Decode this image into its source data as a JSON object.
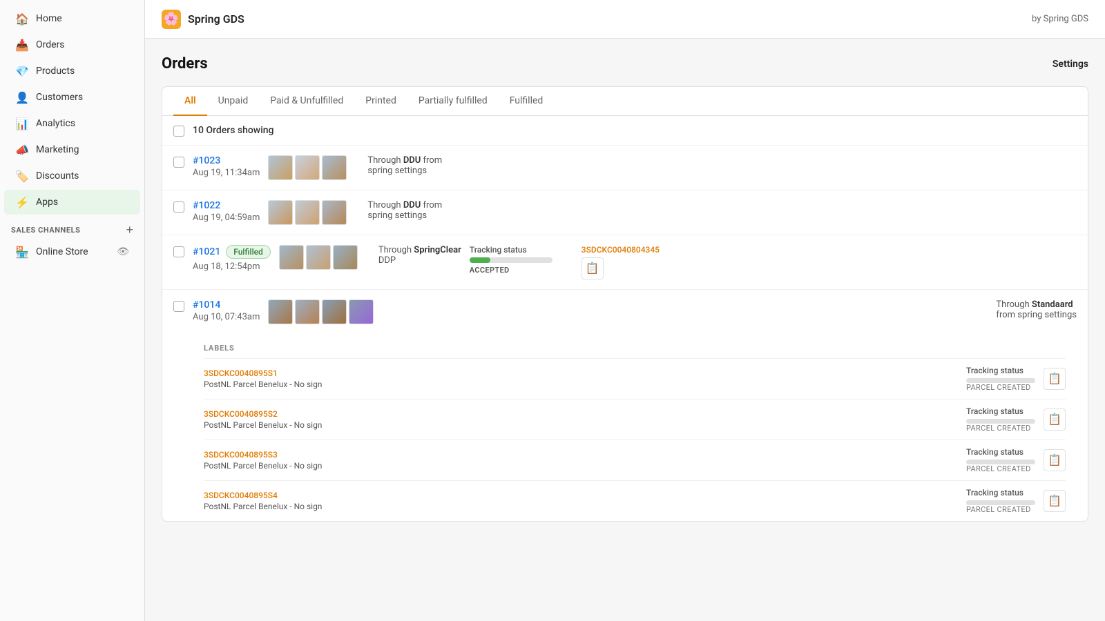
{
  "topbar": {
    "app_name": "Spring GDS",
    "byline": "by Spring GDS",
    "logo_emoji": "🌸"
  },
  "sidebar": {
    "items": [
      {
        "id": "home",
        "label": "Home",
        "icon": "🏠"
      },
      {
        "id": "orders",
        "label": "Orders",
        "icon": "📥"
      },
      {
        "id": "products",
        "label": "Products",
        "icon": "💎"
      },
      {
        "id": "customers",
        "label": "Customers",
        "icon": "👤"
      },
      {
        "id": "analytics",
        "label": "Analytics",
        "icon": "📊"
      },
      {
        "id": "marketing",
        "label": "Marketing",
        "icon": "📣"
      },
      {
        "id": "discounts",
        "label": "Discounts",
        "icon": "🏷️"
      },
      {
        "id": "apps",
        "label": "Apps",
        "icon": "⚡",
        "active": true
      }
    ],
    "sales_channels_label": "SALES CHANNELS",
    "online_store_label": "Online Store"
  },
  "page": {
    "title": "Orders",
    "settings_label": "Settings"
  },
  "tabs": [
    {
      "id": "all",
      "label": "All",
      "active": true
    },
    {
      "id": "unpaid",
      "label": "Unpaid"
    },
    {
      "id": "paid-unfulfilled",
      "label": "Paid & Unfulfilled"
    },
    {
      "id": "printed",
      "label": "Printed"
    },
    {
      "id": "partially-fulfilled",
      "label": "Partially fulfilled"
    },
    {
      "id": "fulfilled",
      "label": "Fulfilled"
    }
  ],
  "orders_showing": "10 Orders showing",
  "orders": [
    {
      "id": "order-1023",
      "number": "#1023",
      "date": "Aug 19, 11:34am",
      "shipping": "Through DDU from spring settings",
      "fulfilled": false,
      "tracking": null,
      "labels": []
    },
    {
      "id": "order-1022",
      "number": "#1022",
      "date": "Aug 19, 04:59am",
      "shipping": "Through DDU from spring settings",
      "fulfilled": false,
      "tracking": null,
      "labels": []
    },
    {
      "id": "order-1021",
      "number": "#1021",
      "date": "Aug 18, 12:54pm",
      "badge": "Fulfilled",
      "shipping": "Through SpringClear DDP",
      "fulfilled": true,
      "tracking_code": "3SDCKC0040804345",
      "tracking_label": "Tracking status",
      "tracking_status": "ACCEPTED",
      "tracking_percent": 25,
      "labels": []
    },
    {
      "id": "order-1014",
      "number": "#1014",
      "date": "Aug 10, 07:43am",
      "shipping": "Through Standaard from spring settings",
      "fulfilled": false,
      "tracking": null,
      "labels": [
        {
          "code": "3SDCKC0040895S1",
          "service": "PostNL Parcel Benelux - No sign",
          "tracking_label": "Tracking status",
          "tracking_status": "PARCEL CREATED"
        },
        {
          "code": "3SDCKC0040895S2",
          "service": "PostNL Parcel Benelux - No sign",
          "tracking_label": "Tracking status",
          "tracking_status": "PARCEL CREATED"
        },
        {
          "code": "3SDCKC0040895S3",
          "service": "PostNL Parcel Benelux - No sign",
          "tracking_label": "Tracking status",
          "tracking_status": "PARCEL CREATED"
        },
        {
          "code": "3SDCKC0040895S4",
          "service": "PostNL Parcel Benelux - No sign",
          "tracking_label": "Tracking status",
          "tracking_status": "PARCEL CREATED"
        }
      ]
    }
  ],
  "labels_section_title": "LABELS"
}
